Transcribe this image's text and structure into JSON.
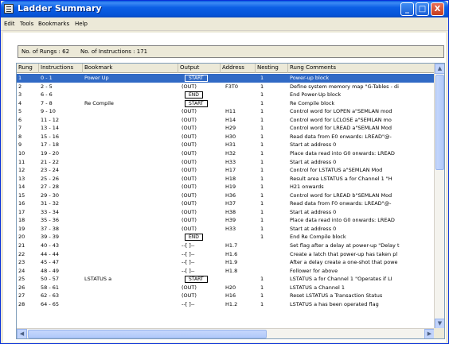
{
  "window": {
    "title": "Ladder Summary"
  },
  "titlebar_buttons": {
    "minimize": "_",
    "maximize": "□",
    "close": "X"
  },
  "menu": [
    "Edit",
    "Tools",
    "Bookmarks",
    "Help"
  ],
  "summary": {
    "rungs": "No. of Rungs : 62",
    "instructions": "No. of Instructions : 171"
  },
  "columns": [
    "Rung",
    "Instructions",
    "Bookmark",
    "Output",
    "Address",
    "Nesting",
    "Rung Comments"
  ],
  "rows": [
    [
      "1",
      "0 - 1",
      "Power Up",
      "START",
      "",
      "1",
      "Power-up block"
    ],
    [
      "2",
      "2 - 5",
      "",
      "(OUT)",
      "F3T0",
      "1",
      "Define system memory map \"G-Tables - di"
    ],
    [
      "3",
      "6 - 6",
      "",
      "END",
      "",
      "1",
      "End Power-Up block"
    ],
    [
      "4",
      "7 - 8",
      "Re Compile",
      "START",
      "",
      "1",
      "Re Compile block"
    ],
    [
      "5",
      "9 - 10",
      "",
      "(OUT)",
      "H11",
      "1",
      "Control word for LOPEN a\"SEMLAN mod"
    ],
    [
      "6",
      "11 - 12",
      "",
      "(OUT)",
      "H14",
      "1",
      "Control word for LCLOSE a\"SEMLAN mo"
    ],
    [
      "7",
      "13 - 14",
      "",
      "(OUT)",
      "H29",
      "1",
      "Control word for LREAD a\"SEMLAN Mod"
    ],
    [
      "8",
      "15 - 16",
      "",
      "(OUT)",
      "H30",
      "1",
      "Read data from E0 onwards: LREAD\"@-"
    ],
    [
      "9",
      "17 - 18",
      "",
      "(OUT)",
      "H31",
      "1",
      "Start at address 0"
    ],
    [
      "10",
      "19 - 20",
      "",
      "(OUT)",
      "H32",
      "1",
      "Place data read into G0 onwards: LREAD"
    ],
    [
      "11",
      "21 - 22",
      "",
      "(OUT)",
      "H33",
      "1",
      "Start at address 0"
    ],
    [
      "12",
      "23 - 24",
      "",
      "(OUT)",
      "H17",
      "1",
      "Control for LSTATUS a\"SEMLAN Mod"
    ],
    [
      "13",
      "25 - 26",
      "",
      "(OUT)",
      "H18",
      "1",
      "Result area LSTATUS a for Channel 1 \"H"
    ],
    [
      "14",
      "27 - 28",
      "",
      "(OUT)",
      "H19",
      "1",
      "H21 onwards"
    ],
    [
      "15",
      "29 - 30",
      "",
      "(OUT)",
      "H36",
      "1",
      "Control word for LREAD b\"SEMLAN Mod"
    ],
    [
      "16",
      "31 - 32",
      "",
      "(OUT)",
      "H37",
      "1",
      "Read data from F0 onwards: LREAD\"@-"
    ],
    [
      "17",
      "33 - 34",
      "",
      "(OUT)",
      "H38",
      "1",
      "Start at address 0"
    ],
    [
      "18",
      "35 - 36",
      "",
      "(OUT)",
      "H39",
      "1",
      "Place data read into G0 onwards: LREAD"
    ],
    [
      "19",
      "37 - 38",
      "",
      "(OUT)",
      "H33",
      "1",
      "Start at address 0"
    ],
    [
      "20",
      "39 - 39",
      "",
      "END",
      "",
      "1",
      "End Re Compile block"
    ],
    [
      "21",
      "40 - 43",
      "",
      "--[ ]--",
      "H1.7",
      "",
      "Set flag after a delay at power-up \"Delay t"
    ],
    [
      "22",
      "44 - 44",
      "",
      "--[ ]--",
      "H1.6",
      "",
      "Create a latch that power-up has taken pl"
    ],
    [
      "23",
      "45 - 47",
      "",
      "--[ ]--",
      "H1.9",
      "",
      "After a delay create a one-shot that powe"
    ],
    [
      "24",
      "48 - 49",
      "",
      "--[ ]--",
      "H1.8",
      "",
      "Follower for above"
    ],
    [
      "25",
      "50 - 57",
      "LSTATUS a",
      "START",
      "",
      "1",
      "LSTATUS a for Channel 1 \"Operates if LI"
    ],
    [
      "26",
      "58 - 61",
      "",
      "(OUT)",
      "H20",
      "1",
      "LSTATUS a Channel 1"
    ],
    [
      "27",
      "62 - 63",
      "",
      "(OUT)",
      "H16",
      "1",
      "Reset LSTATUS a Transaction Status"
    ],
    [
      "28",
      "64 - 65",
      "",
      "--[ ]--",
      "H1.2",
      "1",
      "LSTATUS a has been operated flag"
    ]
  ],
  "colors": {
    "selection": "#316ac5",
    "titlebar": "#0554d8",
    "face": "#ece9d8"
  }
}
